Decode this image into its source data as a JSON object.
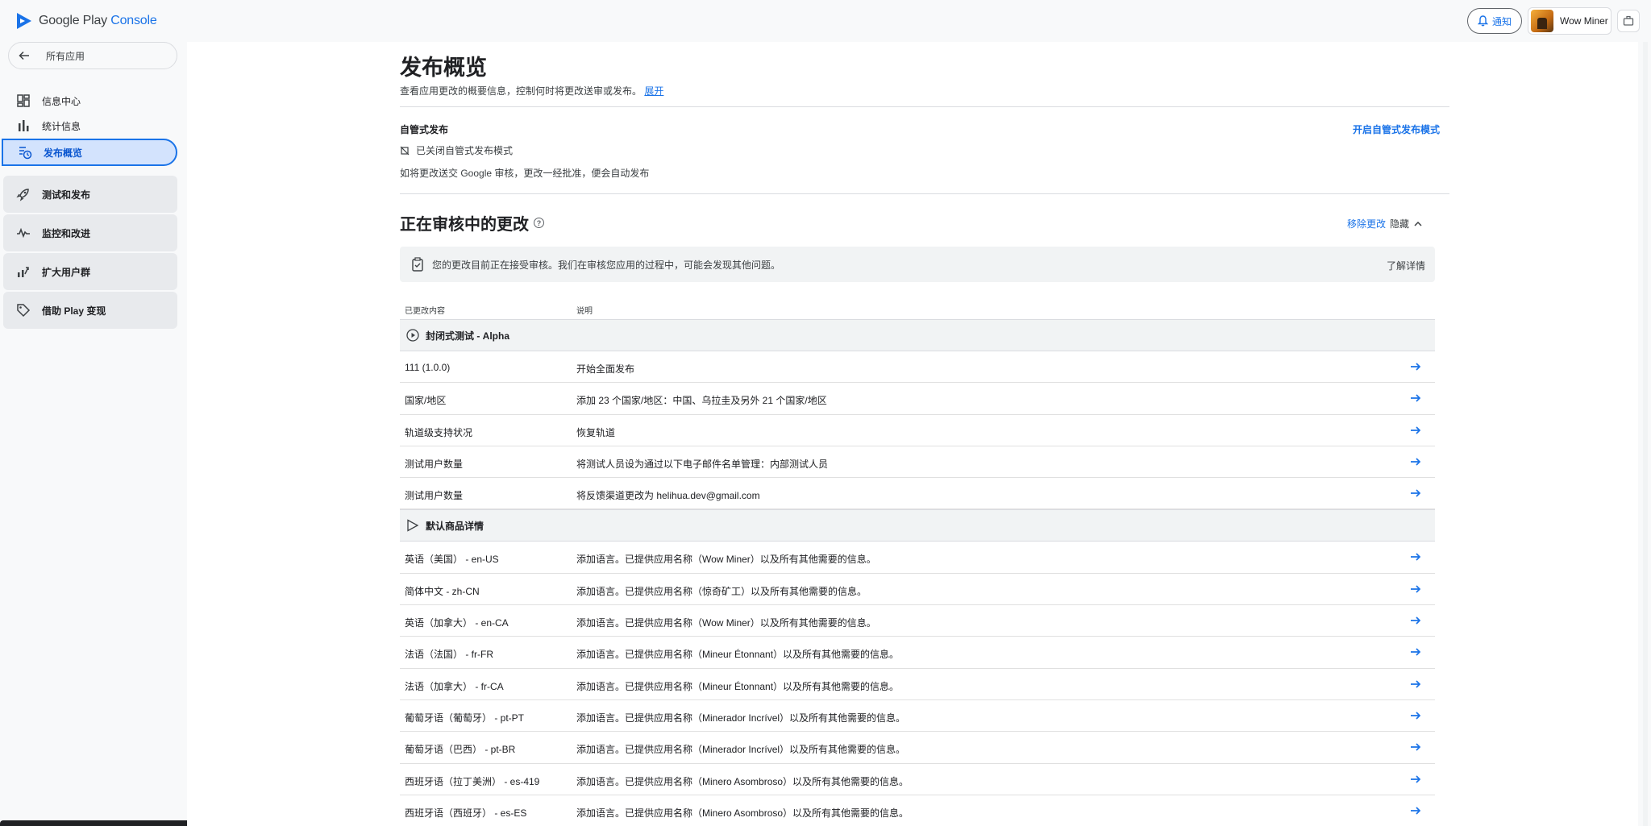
{
  "app": {
    "logo_google_play": "Google Play",
    "logo_console": "Console"
  },
  "topbar": {
    "notify_label": "通知",
    "account_name": "Wow Miner"
  },
  "sidebar": {
    "back_label": "所有应用",
    "items": [
      {
        "label": "信息中心",
        "icon": "dashboard-icon"
      },
      {
        "label": "统计信息",
        "icon": "bar-chart-icon"
      },
      {
        "label": "发布概览",
        "icon": "publishing-overview-icon",
        "active": true
      }
    ],
    "groups": [
      {
        "label": "测试和发布",
        "icon": "rocket-icon"
      },
      {
        "label": "监控和改进",
        "icon": "vitals-icon"
      },
      {
        "label": "扩大用户群",
        "icon": "grow-icon"
      },
      {
        "label": "借助 Play 变现",
        "icon": "tag-icon"
      }
    ]
  },
  "page": {
    "title": "发布概览",
    "subtitle": "查看应用更改的概要信息，控制何时将更改送审或发布。",
    "expand_link": "展开",
    "managed_publishing": {
      "label": "自管式发布",
      "status": "已关闭自管式发布模式",
      "description": "如将更改送交 Google 审核，更改一经批准，便会自动发布",
      "enable_link": "开启自管式发布模式"
    },
    "review": {
      "title": "正在审核中的更改",
      "remove_link": "移除更改",
      "hide_label": "隐藏",
      "banner_text": "您的更改目前正在接受审核。我们在审核您应用的过程中，可能会发现其他问题。",
      "learn_more": "了解详情",
      "col_changes": "已更改内容",
      "col_description": "说明",
      "groups": [
        {
          "title": "封闭式测试 - Alpha",
          "icon": "play-circle-icon",
          "rows": [
            {
              "item": "111 (1.0.0)",
              "desc": "开始全面发布"
            },
            {
              "item": "国家/地区",
              "desc": "添加 23 个国家/地区：中国、乌拉圭及另外 21 个国家/地区"
            },
            {
              "item": "轨道级支持状况",
              "desc": "恢复轨道"
            },
            {
              "item": "测试用户数量",
              "desc": "将测试人员设为通过以下电子邮件名单管理：内部测试人员"
            },
            {
              "item": "测试用户数量",
              "desc": "将反馈渠道更改为 helihua.dev@gmail.com"
            }
          ]
        },
        {
          "title": "默认商品详情",
          "icon": "store-listing-icon",
          "rows": [
            {
              "item": "英语（美国） - en-US",
              "desc": "添加语言。已提供应用名称（Wow Miner）以及所有其他需要的信息。"
            },
            {
              "item": "简体中文 - zh-CN",
              "desc": "添加语言。已提供应用名称（惊奇矿工）以及所有其他需要的信息。"
            },
            {
              "item": "英语（加拿大） - en-CA",
              "desc": "添加语言。已提供应用名称（Wow Miner）以及所有其他需要的信息。"
            },
            {
              "item": "法语（法国） - fr-FR",
              "desc": "添加语言。已提供应用名称（Mineur Étonnant）以及所有其他需要的信息。"
            },
            {
              "item": "法语（加拿大） - fr-CA",
              "desc": "添加语言。已提供应用名称（Mineur Étonnant）以及所有其他需要的信息。"
            },
            {
              "item": "葡萄牙语（葡萄牙） - pt-PT",
              "desc": "添加语言。已提供应用名称（Minerador Incrível）以及所有其他需要的信息。"
            },
            {
              "item": "葡萄牙语（巴西） - pt-BR",
              "desc": "添加语言。已提供应用名称（Minerador Incrível）以及所有其他需要的信息。"
            },
            {
              "item": "西班牙语（拉丁美洲） - es-419",
              "desc": "添加语言。已提供应用名称（Minero Asombroso）以及所有其他需要的信息。"
            },
            {
              "item": "西班牙语（西班牙） - es-ES",
              "desc": "添加语言。已提供应用名称（Minero Asombroso）以及所有其他需要的信息。"
            }
          ]
        }
      ]
    }
  },
  "colors": {
    "accent": "#1a73e8",
    "active_nav_bg": "#d3e3fd",
    "group_row_bg": "#f1f3f4"
  }
}
